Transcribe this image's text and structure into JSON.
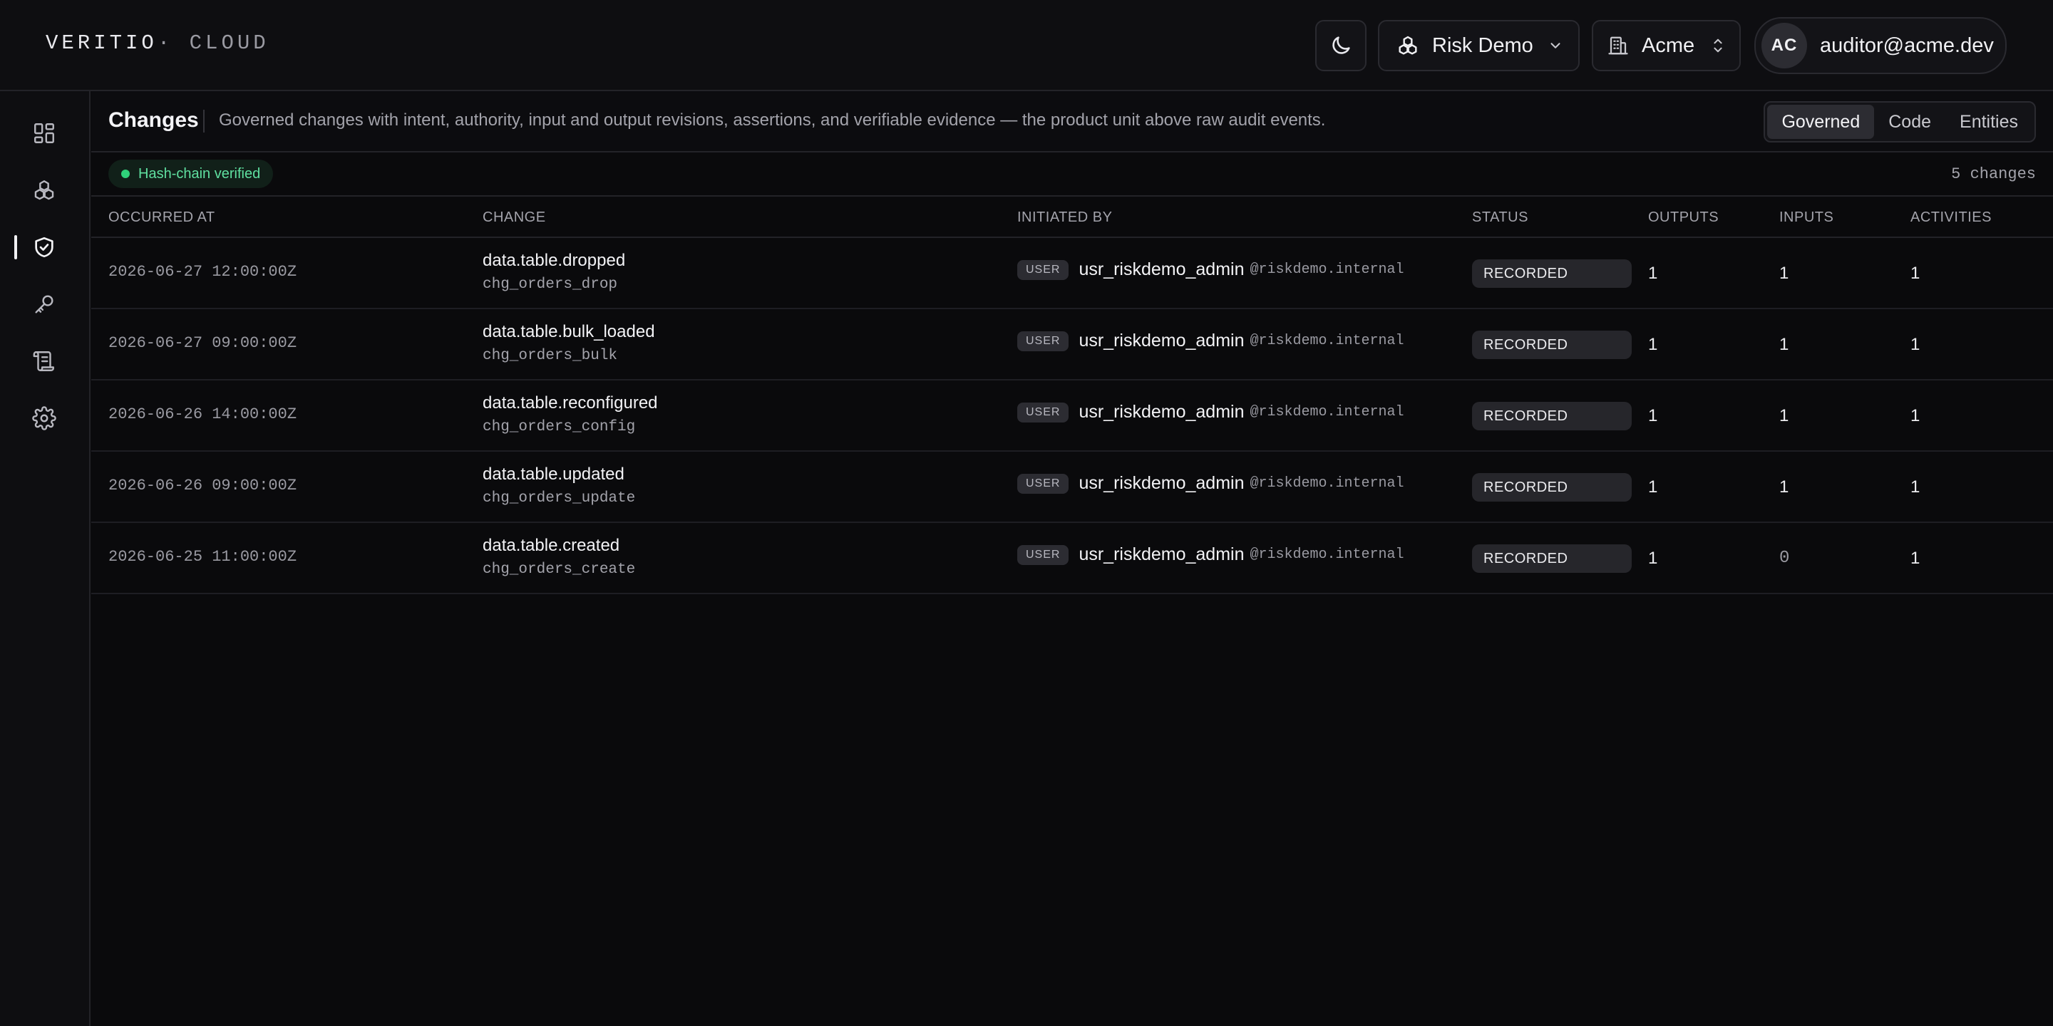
{
  "brand": {
    "name": "VERITIO",
    "separator": "·",
    "product": "CLOUD"
  },
  "topbar": {
    "theme_icon": "moon-icon",
    "project": {
      "label": "Risk Demo",
      "icon": "project-cluster-icon"
    },
    "org": {
      "label": "Acme",
      "icon": "building-icon"
    },
    "user": {
      "initials": "AC",
      "email": "auditor@acme.dev"
    }
  },
  "sidebar": {
    "items": [
      {
        "icon": "dashboard-icon",
        "active": false
      },
      {
        "icon": "cluster-icon",
        "active": false
      },
      {
        "icon": "shield-check-icon",
        "active": true
      },
      {
        "icon": "key-icon",
        "active": false
      },
      {
        "icon": "scroll-icon",
        "active": false
      },
      {
        "icon": "gear-icon",
        "active": false
      }
    ]
  },
  "page": {
    "title": "Changes",
    "description": "Governed changes with intent, authority, input and output revisions, assertions, and verifiable evidence — the product unit above raw audit events.",
    "tabs": [
      {
        "label": "Governed",
        "active": true
      },
      {
        "label": "Code",
        "active": false
      },
      {
        "label": "Entities",
        "active": false
      }
    ]
  },
  "subbar": {
    "verified": "Hash-chain verified",
    "count": "5 changes"
  },
  "table": {
    "columns": {
      "occurred_at": "OCCURRED AT",
      "change": "CHANGE",
      "initiated_by": "INITIATED BY",
      "status": "STATUS",
      "outputs": "OUTPUTS",
      "inputs": "INPUTS",
      "activities": "ACTIVITIES"
    },
    "rows": [
      {
        "occurred_at": "2026-06-27 12:00:00Z",
        "change": "data.table.dropped",
        "change_id": "chg_orders_drop",
        "actor_type": "USER",
        "actor": "usr_riskdemo_admin",
        "actor_domain": "@riskdemo.internal",
        "status": "RECORDED",
        "outputs": "1",
        "inputs": "1",
        "activities": "1"
      },
      {
        "occurred_at": "2026-06-27 09:00:00Z",
        "change": "data.table.bulk_loaded",
        "change_id": "chg_orders_bulk",
        "actor_type": "USER",
        "actor": "usr_riskdemo_admin",
        "actor_domain": "@riskdemo.internal",
        "status": "RECORDED",
        "outputs": "1",
        "inputs": "1",
        "activities": "1"
      },
      {
        "occurred_at": "2026-06-26 14:00:00Z",
        "change": "data.table.reconfigured",
        "change_id": "chg_orders_config",
        "actor_type": "USER",
        "actor": "usr_riskdemo_admin",
        "actor_domain": "@riskdemo.internal",
        "status": "RECORDED",
        "outputs": "1",
        "inputs": "1",
        "activities": "1"
      },
      {
        "occurred_at": "2026-06-26 09:00:00Z",
        "change": "data.table.updated",
        "change_id": "chg_orders_update",
        "actor_type": "USER",
        "actor": "usr_riskdemo_admin",
        "actor_domain": "@riskdemo.internal",
        "status": "RECORDED",
        "outputs": "1",
        "inputs": "1",
        "activities": "1"
      },
      {
        "occurred_at": "2026-06-25 11:00:00Z",
        "change": "data.table.created",
        "change_id": "chg_orders_create",
        "actor_type": "USER",
        "actor": "usr_riskdemo_admin",
        "actor_domain": "@riskdemo.internal",
        "status": "RECORDED",
        "outputs": "1",
        "inputs": "0",
        "activities": "1"
      }
    ]
  }
}
